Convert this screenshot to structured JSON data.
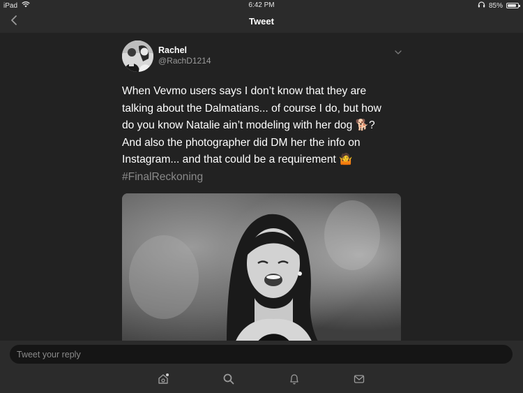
{
  "status_bar": {
    "device": "iPad",
    "time": "6:42 PM",
    "battery_percent": "85%",
    "battery_level": 0.85
  },
  "nav": {
    "title": "Tweet",
    "back_icon": "chevron-left-icon"
  },
  "tweet": {
    "author_name": "Rachel",
    "author_handle": "@RachD1214",
    "text_lines": [
      "When Vevmo users says I don’t know that they are",
      "talking about the Dalmatians... of course I do, but how",
      "do you know Natalie ain’t modeling with her dog 🐕?",
      "And also the photographer did DM her the info on",
      "Instagram... and that could be a requirement 🤷"
    ],
    "hashtag": "#FinalReckoning"
  },
  "reply": {
    "placeholder": "Tweet your reply"
  },
  "tab_bar": {
    "items": [
      "home-icon",
      "search-icon",
      "notifications-icon",
      "messages-icon"
    ]
  },
  "colors": {
    "background": "#222222",
    "bars": "#2b2b2b",
    "secondary_text": "#9b9b9b"
  }
}
